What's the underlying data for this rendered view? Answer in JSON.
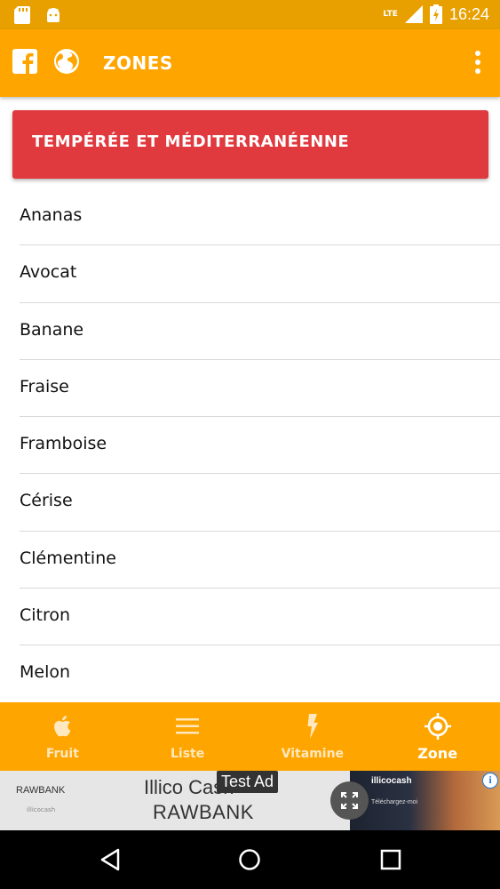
{
  "colors": {
    "status_bar": "#E8A000",
    "app_bar": "#FFA500",
    "zone_card": "#E0393E",
    "bottom_nav": "#FFA500",
    "system_nav": "#000000"
  },
  "status_bar": {
    "left_icons": [
      "sd-card-icon",
      "android-icon"
    ],
    "network": "LTE",
    "time": "16:24"
  },
  "app_bar": {
    "title": "ZONES",
    "icons": [
      "facebook-icon",
      "globe-icon",
      "more-vert-icon"
    ]
  },
  "zone_card": {
    "label": "TEMPÉRÉE ET MÉDITERRANÉENNE"
  },
  "fruits": [
    "Ananas",
    "Avocat",
    "Banane",
    "Fraise",
    "Framboise",
    "Cérise",
    "Clémentine",
    "Citron",
    "Melon"
  ],
  "bottom_nav": {
    "items": [
      {
        "label": "Fruit",
        "icon": "apple-icon",
        "active": false
      },
      {
        "label": "Liste",
        "icon": "list-icon",
        "active": false
      },
      {
        "label": "Vitamine",
        "icon": "lightning-icon",
        "active": false
      },
      {
        "label": "Zone",
        "icon": "target-icon",
        "active": true
      }
    ]
  },
  "ad": {
    "logo": "RAWBANK",
    "logo_sub": "illicocash",
    "title": "Illico Cash",
    "subtitle": "RAWBANK",
    "test_label": "Test Ad",
    "image_brand": "illicocash",
    "image_cta": "Téléchargez-moi",
    "info_icon": "info-icon"
  },
  "system_nav": [
    "back-icon",
    "home-icon",
    "recents-icon"
  ]
}
